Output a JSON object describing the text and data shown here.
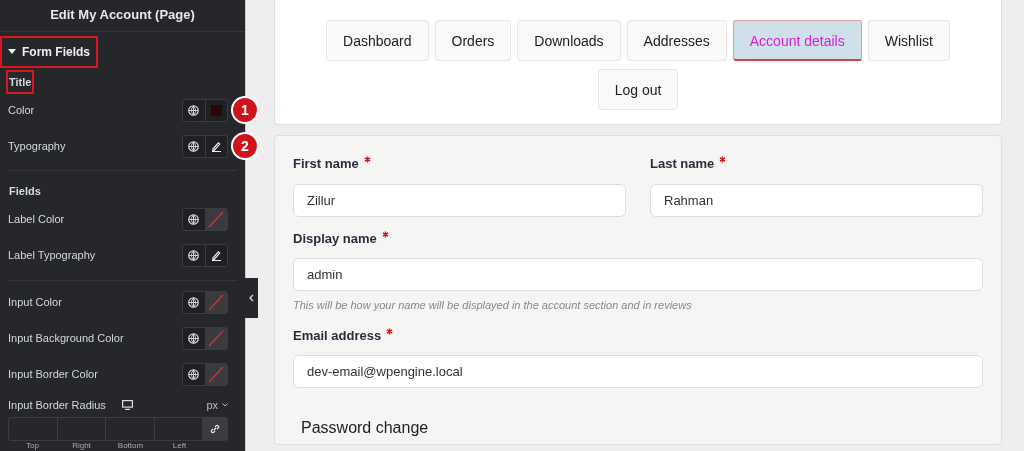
{
  "sidebar": {
    "title": "Edit My Account (Page)",
    "section": {
      "label": "Form Fields",
      "expanded": true,
      "highlighted": true
    },
    "groups": [
      {
        "heading": "Title",
        "highlighted": true,
        "rows": [
          {
            "label": "Color",
            "kind": "color",
            "color": "#2a0606",
            "badge": "1"
          },
          {
            "label": "Typography",
            "kind": "typography",
            "badge": "2"
          }
        ]
      },
      {
        "heading": "Fields",
        "highlighted": false,
        "rows": [
          {
            "label": "Label Color",
            "kind": "unset"
          },
          {
            "label": "Label Typography",
            "kind": "typography"
          }
        ]
      },
      {
        "rows": [
          {
            "label": "Input Color",
            "kind": "unset"
          },
          {
            "label": "Input Background Color",
            "kind": "unset"
          },
          {
            "label": "Input Border Color",
            "kind": "unset"
          }
        ]
      }
    ],
    "dimensions": {
      "label": "Input Border Radius",
      "unit": "px",
      "sides": [
        "Top",
        "Right",
        "Bottom",
        "Left"
      ]
    }
  },
  "tabs": [
    {
      "label": "Dashboard",
      "selected": false
    },
    {
      "label": "Orders",
      "selected": false
    },
    {
      "label": "Downloads",
      "selected": false
    },
    {
      "label": "Addresses",
      "selected": false
    },
    {
      "label": "Account details",
      "selected": true
    },
    {
      "label": "Wishlist",
      "selected": false
    },
    {
      "label": "Log out",
      "selected": false
    }
  ],
  "form": {
    "fields": [
      {
        "label": "First name",
        "required": true,
        "value": "Zillur",
        "kind": "half"
      },
      {
        "label": "Last name",
        "required": true,
        "value": "Rahman",
        "kind": "half"
      },
      {
        "label": "Display name",
        "required": true,
        "value": "admin",
        "kind": "full",
        "hint": "This will be how your name will be displayed in the account section and in reviews"
      },
      {
        "label": "Email address",
        "required": true,
        "value": "dev-email@wpengine.local",
        "kind": "full"
      }
    ],
    "section_title": "Password change"
  }
}
